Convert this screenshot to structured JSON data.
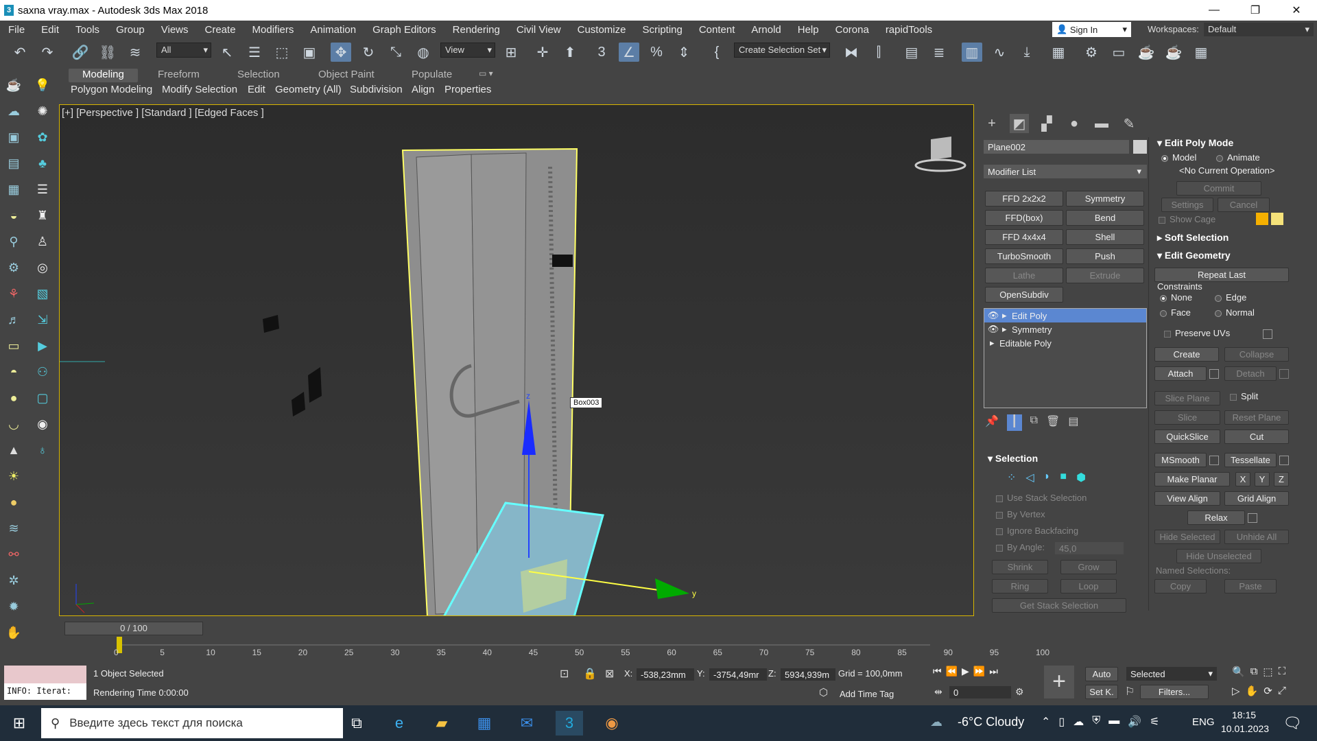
{
  "app": {
    "title": "saxna vray.max - Autodesk 3ds Max 2018"
  },
  "menu": [
    "File",
    "Edit",
    "Tools",
    "Group",
    "Views",
    "Create",
    "Modifiers",
    "Animation",
    "Graph Editors",
    "Rendering",
    "Civil View",
    "Customize",
    "Scripting",
    "Content",
    "Arnold",
    "Help",
    "Corona",
    "rapidTools"
  ],
  "signin": "Sign In",
  "workspaces_label": "Workspaces:",
  "workspace": "Default",
  "toolbar": {
    "filter": "All",
    "ref_coord": "View",
    "selection_set": "Create Selection Set"
  },
  "ribbon": {
    "tabs": [
      "Modeling",
      "Freeform",
      "Selection",
      "Object Paint",
      "Populate"
    ],
    "sub": [
      "Polygon Modeling",
      "Modify Selection",
      "Edit",
      "Geometry (All)",
      "Subdivision",
      "Align",
      "Properties"
    ]
  },
  "viewport": {
    "label": "[+] [Perspective ] [Standard ] [Edged Faces ]",
    "tooltip": "Box003",
    "axis_z": "z",
    "axis_y": "y"
  },
  "cmd": {
    "object_name": "Plane002",
    "modifier_list": "Modifier List",
    "buttons": [
      "FFD 2x2x2",
      "Symmetry",
      "FFD(box)",
      "Bend",
      "FFD 4x4x4",
      "Shell",
      "TurboSmooth",
      "Push",
      "Lathe",
      "Extrude",
      "OpenSubdiv"
    ],
    "stack": [
      "Edit Poly",
      "Symmetry",
      "Editable Poly"
    ],
    "selection": {
      "title": "Selection",
      "use_stack": "Use Stack Selection",
      "by_vertex": "By Vertex",
      "ignore_backfacing": "Ignore Backfacing",
      "by_angle": "By Angle:",
      "angle_value": "45,0",
      "shrink": "Shrink",
      "grow": "Grow",
      "ring": "Ring",
      "loop": "Loop",
      "get_stack": "Get Stack Selection"
    }
  },
  "editpoly": {
    "mode_title": "Edit Poly Mode",
    "model": "Model",
    "animate": "Animate",
    "no_op": "<No Current Operation>",
    "commit": "Commit",
    "settings": "Settings",
    "cancel": "Cancel",
    "show_cage": "Show Cage",
    "soft_sel": "Soft Selection",
    "edit_geom": "Edit Geometry",
    "repeat_last": "Repeat Last",
    "constraints": "Constraints",
    "none": "None",
    "edge": "Edge",
    "face": "Face",
    "normal": "Normal",
    "preserve_uvs": "Preserve UVs",
    "create": "Create",
    "collapse": "Collapse",
    "attach": "Attach",
    "detach": "Detach",
    "slice_plane": "Slice Plane",
    "split": "Split",
    "slice": "Slice",
    "reset_plane": "Reset Plane",
    "quickslice": "QuickSlice",
    "cut": "Cut",
    "msmooth": "MSmooth",
    "tessellate": "Tessellate",
    "make_planar": "Make Planar",
    "x": "X",
    "y": "Y",
    "z": "Z",
    "view_align": "View Align",
    "grid_align": "Grid Align",
    "relax": "Relax",
    "hide_selected": "Hide Selected",
    "unhide_all": "Unhide All",
    "hide_unselected": "Hide Unselected",
    "named_sel": "Named Selections:",
    "copy": "Copy",
    "paste": "Paste"
  },
  "timeline": {
    "frame": "0 / 100",
    "ticks": [
      "0",
      "5",
      "10",
      "15",
      "20",
      "25",
      "30",
      "35",
      "40",
      "45",
      "50",
      "55",
      "60",
      "65",
      "70",
      "75",
      "80",
      "85",
      "90",
      "95",
      "100"
    ]
  },
  "status": {
    "info": "INFO: Iterat:",
    "selected": "1 Object Selected",
    "render_time": "Rendering Time  0:00:00",
    "x_label": "X:",
    "x": "-538,23mm",
    "y_label": "Y:",
    "y": "-3754,49mr",
    "z_label": "Z:",
    "z": "5934,939m",
    "grid": "Grid = 100,0mm",
    "add_time_tag": "Add Time Tag",
    "auto": "Auto",
    "setk": "Set K.",
    "selected_dd": "Selected",
    "filters": "Filters...",
    "frame_input": "0"
  },
  "taskbar": {
    "search": "Введите здесь текст для поиска",
    "weather": "-6°C  Cloudy",
    "lang": "ENG",
    "time": "18:15",
    "date": "10.01.2023"
  }
}
